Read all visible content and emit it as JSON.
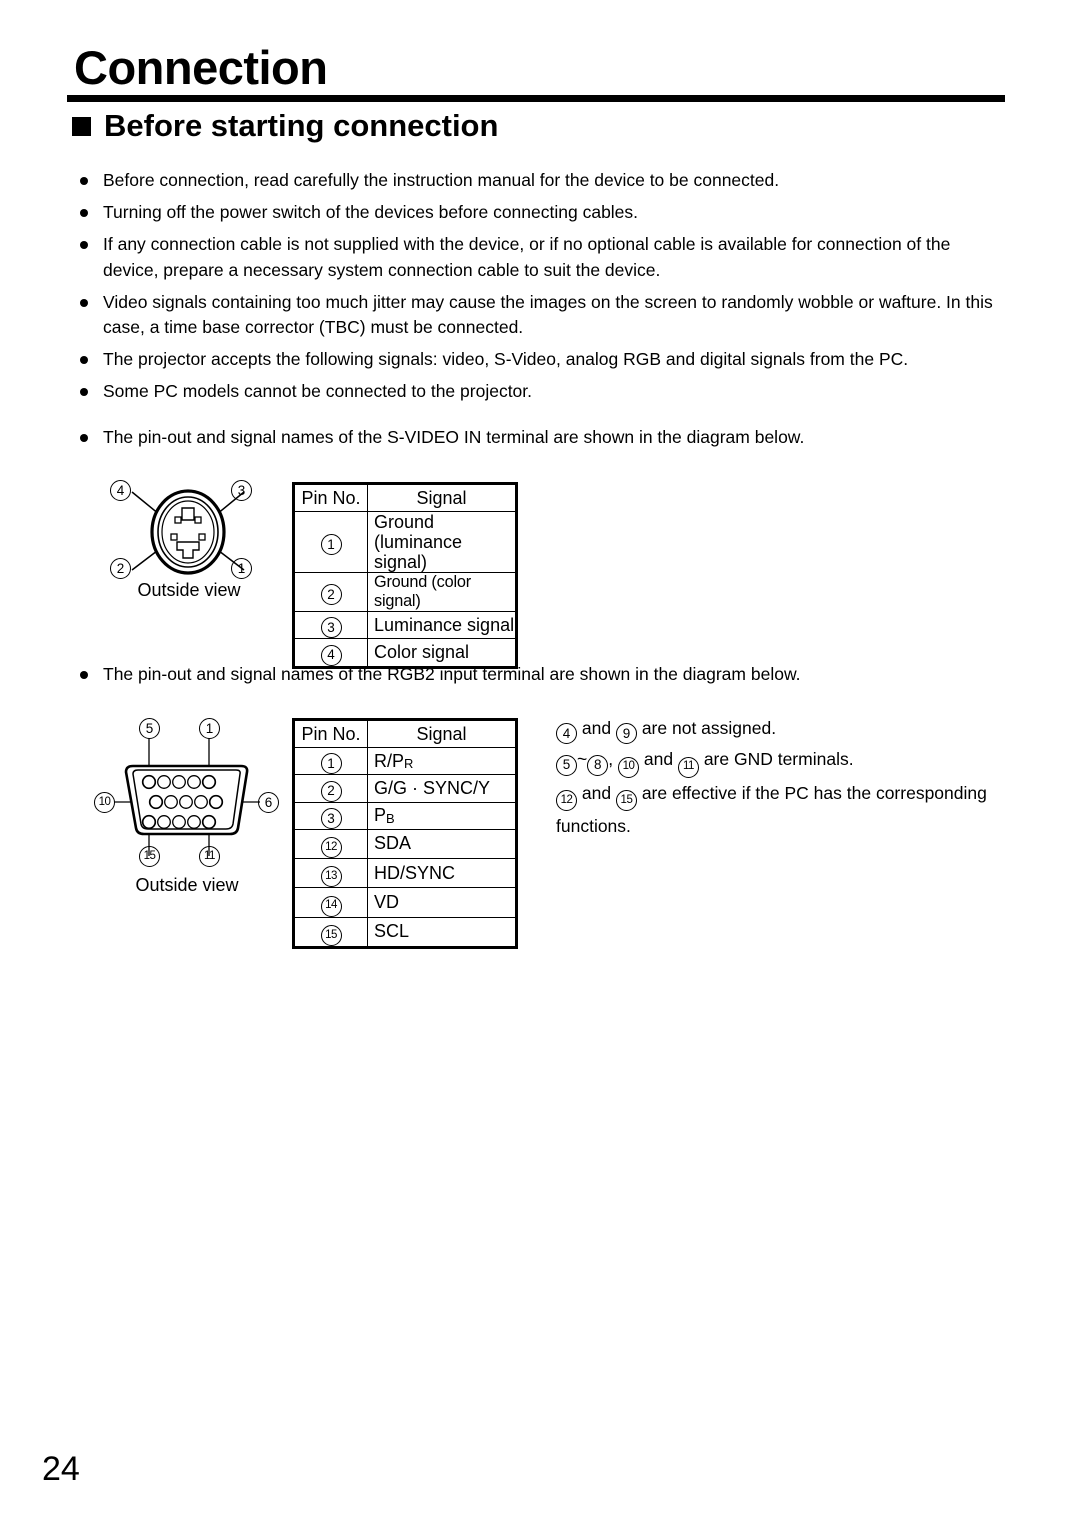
{
  "document": {
    "chapter_title": "Connection",
    "section_heading": "Before starting connection",
    "page_number": "24"
  },
  "intro_bullets": [
    "Before connection, read carefully the instruction manual for the device to be connected.",
    "Turning off the power switch of the devices before connecting cables.",
    "If any connection cable is not supplied with the device, or if no optional cable is available for connection of the device, prepare a necessary system connection cable to suit the device.",
    "Video signals containing too much jitter may cause the images on the screen to randomly wobble or wafture.  In this case, a time base corrector (TBC) must be connected.",
    "The projector accepts the following signals: video, S-Video, analog RGB and digital signals from the PC.",
    "Some PC models cannot be connected to the projector."
  ],
  "svideo": {
    "intro": "The pin-out and signal names of the S-VIDEO IN terminal are shown in the diagram below.",
    "diagram_caption": "Outside view",
    "diagram_pin_labels": {
      "top_left": "4",
      "top_right": "3",
      "bottom_left": "2",
      "bottom_right": "1"
    },
    "table": {
      "headers": [
        "Pin No.",
        "Signal"
      ],
      "rows": [
        {
          "pin": "1",
          "signal_line1": "Ground",
          "signal_line2": "(luminance signal)"
        },
        {
          "pin": "2",
          "signal_line1": "Ground (color signal)",
          "signal_line2": ""
        },
        {
          "pin": "3",
          "signal_line1": "Luminance signal",
          "signal_line2": ""
        },
        {
          "pin": "4",
          "signal_line1": "Color signal",
          "signal_line2": ""
        }
      ]
    }
  },
  "rgb2": {
    "intro": "The pin-out and signal names of the RGB2 input terminal are shown in the diagram below.",
    "diagram_caption": "Outside view",
    "diagram_pin_labels": {
      "top_left": "5",
      "top_right": "1",
      "mid_left": "10",
      "mid_right": "6",
      "bottom_left": "15",
      "bottom_right": "11"
    },
    "table": {
      "headers": [
        "Pin No.",
        "Signal"
      ],
      "rows": [
        {
          "pin": "1",
          "signal": "R/PR",
          "sig_main": "R/P",
          "sig_sub": "R"
        },
        {
          "pin": "2",
          "signal": "G/G · SYNC/Y",
          "sig_main": "G/G · SYNC/Y",
          "sig_sub": ""
        },
        {
          "pin": "3",
          "signal": "PB",
          "sig_main": "P",
          "sig_sub": "B"
        },
        {
          "pin": "12",
          "signal": "SDA",
          "sig_main": "SDA",
          "sig_sub": ""
        },
        {
          "pin": "13",
          "signal": "HD/SYNC",
          "sig_main": "HD/SYNC",
          "sig_sub": ""
        },
        {
          "pin": "14",
          "signal": "VD",
          "sig_main": "VD",
          "sig_sub": ""
        },
        {
          "pin": "15",
          "signal": "SCL",
          "sig_main": "SCL",
          "sig_sub": ""
        }
      ]
    },
    "notes": {
      "line1_a": "and",
      "line1_b": "are not assigned.",
      "line1_pins": [
        "4",
        "9"
      ],
      "line2_tilde": "~",
      "line2_comma": ",",
      "line2_and": "and",
      "line2_tail": "are GND terminals.",
      "line2_pins": [
        "5",
        "8",
        "10",
        "11"
      ],
      "line3_and": "and",
      "line3_tail": "are effective if the PC has the corresponding",
      "line3_pins": [
        "12",
        "15"
      ],
      "line4": "functions."
    }
  },
  "colors": {
    "ink": "#000000",
    "paper": "#ffffff"
  }
}
